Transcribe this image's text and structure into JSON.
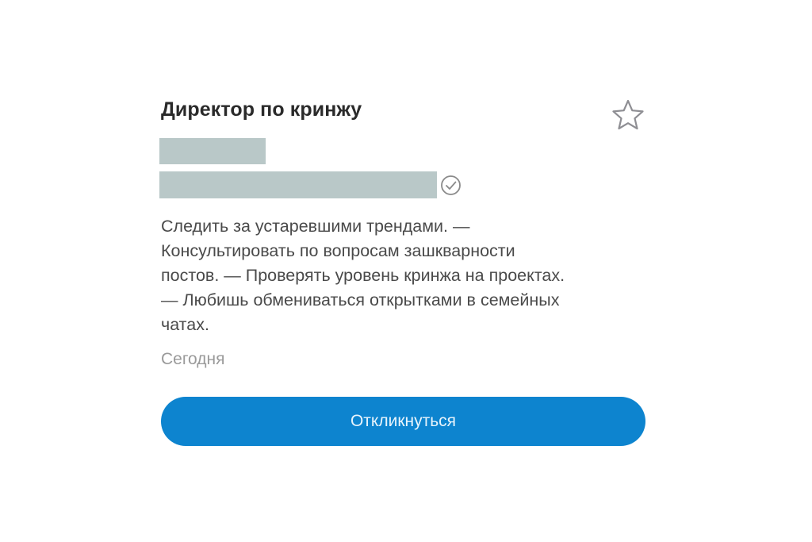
{
  "vacancy": {
    "title": "Директор по кринжу",
    "description_lines": [
      "Следить за устаревшими трендами. —",
      "Консультировать по вопросам зашкварности",
      "постов. — Проверять уровень кринжа на проектах.",
      "— Любишь обмениваться открытками в семейных",
      "чатах."
    ],
    "date": "Сегодня"
  },
  "actions": {
    "respond_label": "Откликнуться"
  },
  "icons": {
    "favorite": "star-icon",
    "verified": "check-circle-icon"
  },
  "colors": {
    "button": "#0d84cf",
    "button_text": "#e8f4fc",
    "redaction": "#b9c8c8",
    "title": "#2a2a2a",
    "body_text": "#4a4a4a",
    "muted_text": "#9a9a9a"
  }
}
